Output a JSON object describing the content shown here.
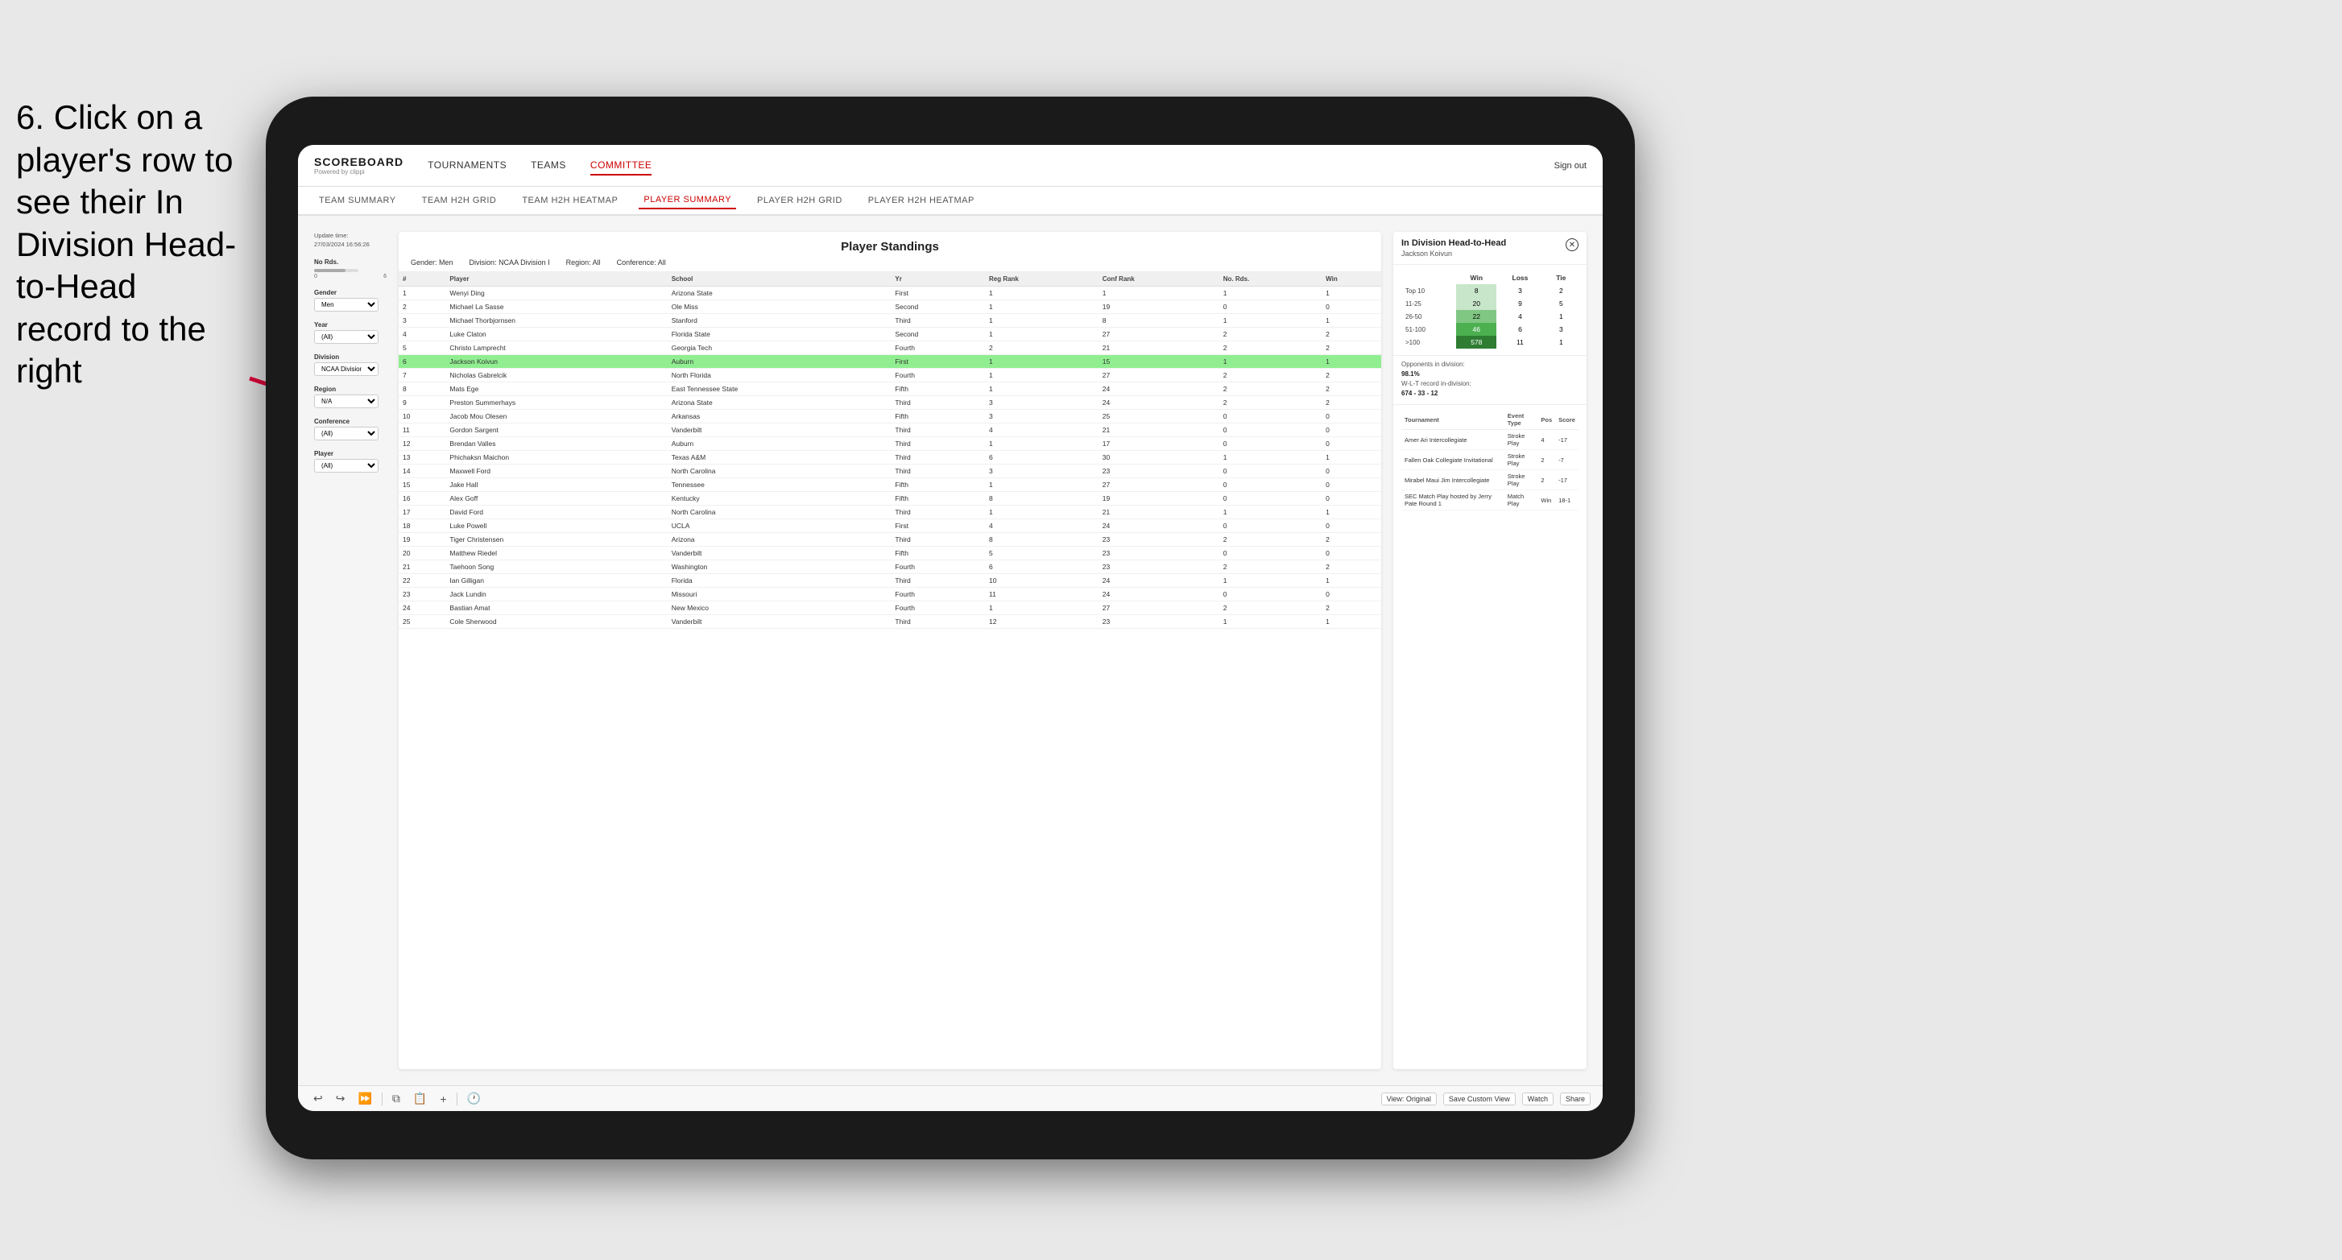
{
  "instruction": {
    "text": "6. Click on a player's row to see their In Division Head-to-Head record to the right"
  },
  "nav": {
    "logo": "SCOREBOARD",
    "logo_sub": "Powered by clippi",
    "items": [
      "TOURNAMENTS",
      "TEAMS",
      "COMMITTEE"
    ],
    "active_item": "COMMITTEE",
    "sign_out": "Sign out"
  },
  "sub_nav": {
    "items": [
      "TEAM SUMMARY",
      "TEAM H2H GRID",
      "TEAM H2H HEATMAP",
      "PLAYER SUMMARY",
      "PLAYER H2H GRID",
      "PLAYER H2H HEATMAP"
    ],
    "active": "PLAYER SUMMARY"
  },
  "filters": {
    "update_label": "Update time:",
    "update_time": "27/03/2024 16:56:26",
    "no_rds_label": "No Rds.",
    "gender_label": "Gender",
    "gender_value": "Men",
    "year_label": "Year",
    "year_value": "(All)",
    "division_label": "Division",
    "division_value": "NCAA Division I",
    "region_label": "Region",
    "region_value": "N/A",
    "conference_label": "Conference",
    "conference_value": "(All)",
    "player_label": "Player",
    "player_value": "(All)"
  },
  "standings": {
    "title": "Player Standings",
    "gender_label": "Gender:",
    "gender_value": "Men",
    "division_label": "Division:",
    "division_value": "NCAA Division I",
    "region_label": "Region:",
    "region_value": "All",
    "conference_label": "Conference:",
    "conference_value": "All",
    "columns": [
      "#",
      "Player",
      "School",
      "Yr",
      "Reg Rank",
      "Conf Rank",
      "No. Rds.",
      "Win"
    ],
    "rows": [
      {
        "num": 1,
        "player": "Wenyi Ding",
        "school": "Arizona State",
        "yr": "First",
        "reg": 1,
        "conf": 1,
        "rds": 1,
        "win": 1
      },
      {
        "num": 2,
        "player": "Michael La Sasse",
        "school": "Ole Miss",
        "yr": "Second",
        "reg": 1,
        "conf": 19,
        "rds": 0,
        "win": 0
      },
      {
        "num": 3,
        "player": "Michael Thorbjornsen",
        "school": "Stanford",
        "yr": "Third",
        "reg": 1,
        "conf": 8,
        "rds": 1,
        "win": 1
      },
      {
        "num": 4,
        "player": "Luke Claton",
        "school": "Florida State",
        "yr": "Second",
        "reg": 1,
        "conf": 27,
        "rds": 2,
        "win": 2
      },
      {
        "num": 5,
        "player": "Christo Lamprecht",
        "school": "Georgia Tech",
        "yr": "Fourth",
        "reg": 2,
        "conf": 21,
        "rds": 2,
        "win": 2
      },
      {
        "num": 6,
        "player": "Jackson Koivun",
        "school": "Auburn",
        "yr": "First",
        "reg": 1,
        "conf": 15,
        "rds": 1,
        "win": 1,
        "highlighted": true
      },
      {
        "num": 7,
        "player": "Nicholas Gabrelcik",
        "school": "North Florida",
        "yr": "Fourth",
        "reg": 1,
        "conf": 27,
        "rds": 2,
        "win": 2
      },
      {
        "num": 8,
        "player": "Mats Ege",
        "school": "East Tennessee State",
        "yr": "Fifth",
        "reg": 1,
        "conf": 24,
        "rds": 2,
        "win": 2
      },
      {
        "num": 9,
        "player": "Preston Summerhays",
        "school": "Arizona State",
        "yr": "Third",
        "reg": 3,
        "conf": 24,
        "rds": 2,
        "win": 2
      },
      {
        "num": 10,
        "player": "Jacob Mou Olesen",
        "school": "Arkansas",
        "yr": "Fifth",
        "reg": 3,
        "conf": 25,
        "rds": 0,
        "win": 0
      },
      {
        "num": 11,
        "player": "Gordon Sargent",
        "school": "Vanderbilt",
        "yr": "Third",
        "reg": 4,
        "conf": 21,
        "rds": 0,
        "win": 0
      },
      {
        "num": 12,
        "player": "Brendan Valles",
        "school": "Auburn",
        "yr": "Third",
        "reg": 1,
        "conf": 17,
        "rds": 0,
        "win": 0
      },
      {
        "num": 13,
        "player": "Phichaksn Maichon",
        "school": "Texas A&M",
        "yr": "Third",
        "reg": 6,
        "conf": 30,
        "rds": 1,
        "win": 1
      },
      {
        "num": 14,
        "player": "Maxwell Ford",
        "school": "North Carolina",
        "yr": "Third",
        "reg": 3,
        "conf": 23,
        "rds": 0,
        "win": 0
      },
      {
        "num": 15,
        "player": "Jake Hall",
        "school": "Tennessee",
        "yr": "Fifth",
        "reg": 1,
        "conf": 27,
        "rds": 0,
        "win": 0
      },
      {
        "num": 16,
        "player": "Alex Goff",
        "school": "Kentucky",
        "yr": "Fifth",
        "reg": 8,
        "conf": 19,
        "rds": 0,
        "win": 0
      },
      {
        "num": 17,
        "player": "David Ford",
        "school": "North Carolina",
        "yr": "Third",
        "reg": 1,
        "conf": 21,
        "rds": 1,
        "win": 1
      },
      {
        "num": 18,
        "player": "Luke Powell",
        "school": "UCLA",
        "yr": "First",
        "reg": 4,
        "conf": 24,
        "rds": 0,
        "win": 0
      },
      {
        "num": 19,
        "player": "Tiger Christensen",
        "school": "Arizona",
        "yr": "Third",
        "reg": 8,
        "conf": 23,
        "rds": 2,
        "win": 2
      },
      {
        "num": 20,
        "player": "Matthew Riedel",
        "school": "Vanderbilt",
        "yr": "Fifth",
        "reg": 5,
        "conf": 23,
        "rds": 0,
        "win": 0
      },
      {
        "num": 21,
        "player": "Taehoon Song",
        "school": "Washington",
        "yr": "Fourth",
        "reg": 6,
        "conf": 23,
        "rds": 2,
        "win": 2
      },
      {
        "num": 22,
        "player": "Ian Gilligan",
        "school": "Florida",
        "yr": "Third",
        "reg": 10,
        "conf": 24,
        "rds": 1,
        "win": 1
      },
      {
        "num": 23,
        "player": "Jack Lundin",
        "school": "Missouri",
        "yr": "Fourth",
        "reg": 11,
        "conf": 24,
        "rds": 0,
        "win": 0
      },
      {
        "num": 24,
        "player": "Bastian Amat",
        "school": "New Mexico",
        "yr": "Fourth",
        "reg": 1,
        "conf": 27,
        "rds": 2,
        "win": 2
      },
      {
        "num": 25,
        "player": "Cole Sherwood",
        "school": "Vanderbilt",
        "yr": "Third",
        "reg": 12,
        "conf": 23,
        "rds": 1,
        "win": 1
      }
    ]
  },
  "h2h": {
    "title": "In Division Head-to-Head",
    "player_name": "Jackson Koivun",
    "table_headers": [
      "",
      "Win",
      "Loss",
      "Tie"
    ],
    "rows": [
      {
        "rank": "Top 10",
        "win": 8,
        "loss": 3,
        "tie": 2,
        "win_color": "green_light"
      },
      {
        "rank": "11-25",
        "win": 20,
        "loss": 9,
        "tie": 5,
        "win_color": "green_mid"
      },
      {
        "rank": "26-50",
        "win": 22,
        "loss": 4,
        "tie": 1,
        "win_color": "green_mid"
      },
      {
        "rank": "51-100",
        "win": 46,
        "loss": 6,
        "tie": 3,
        "win_color": "green_dark"
      },
      {
        "rank": ">100",
        "win": 578,
        "loss": 11,
        "tie": 1,
        "win_color": "green_strong"
      }
    ],
    "opponents_label": "Opponents in division:",
    "opponents_value": "98.1%",
    "wlt_label": "W-L-T record in-division:",
    "wlt_value": "674 - 33 - 12",
    "tournament_headers": [
      "Tournament",
      "Event Type",
      "Pos",
      "Score"
    ],
    "tournaments": [
      {
        "name": "Amer Ari Intercollegiate",
        "type": "Stroke Play",
        "pos": 4,
        "score": "-17"
      },
      {
        "name": "Fallen Oak Collegiate Invitational",
        "type": "Stroke Play",
        "pos": 2,
        "score": "-7"
      },
      {
        "name": "Mirabel Maui Jim Intercollegiate",
        "type": "Stroke Play",
        "pos": 2,
        "score": "-17"
      },
      {
        "name": "SEC Match Play hosted by Jerry Pate Round 1",
        "type": "Match Play",
        "pos": "Win",
        "score": "18-1"
      }
    ]
  },
  "toolbar": {
    "view_original": "View: Original",
    "save_custom": "Save Custom View",
    "watch": "Watch",
    "share": "Share"
  }
}
